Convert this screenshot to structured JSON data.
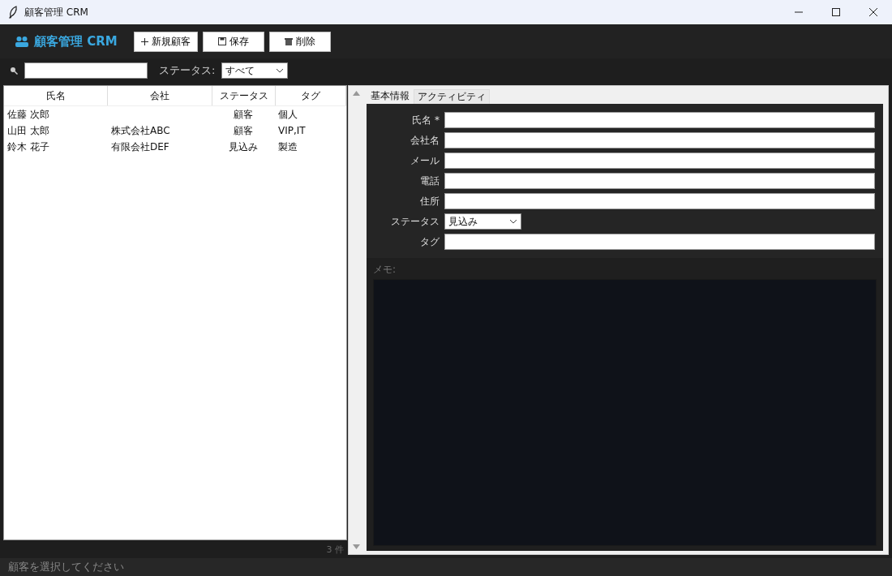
{
  "window": {
    "title": "顧客管理 CRM"
  },
  "header": {
    "title": "顧客管理 CRM",
    "buttons": [
      {
        "label": "新規顧客",
        "kind": "plus"
      },
      {
        "label": "保存",
        "kind": "save"
      },
      {
        "label": "削除",
        "kind": "trash"
      }
    ]
  },
  "filter": {
    "status_label": "ステータス:",
    "status_value": "すべて"
  },
  "table": {
    "columns": [
      "氏名",
      "会社",
      "ステータス",
      "タグ"
    ],
    "rows": [
      {
        "cells": [
          "佐藤 次郎",
          "",
          "顧客",
          "個人"
        ]
      },
      {
        "cells": [
          "山田 太郎",
          "株式会社ABC",
          "顧客",
          "VIP,IT"
        ]
      },
      {
        "cells": [
          "鈴木 花子",
          "有限会社DEF",
          "見込み",
          "製造"
        ]
      }
    ],
    "count": "3 件"
  },
  "tabs": [
    {
      "label": "基本情報",
      "selected": true
    },
    {
      "label": "アクティビティ",
      "selected": false
    }
  ],
  "form": {
    "fields": [
      {
        "label": "氏名 *",
        "kind": "text"
      },
      {
        "label": "会社名",
        "kind": "text"
      },
      {
        "label": "メール",
        "kind": "text"
      },
      {
        "label": "電話",
        "kind": "text"
      },
      {
        "label": "住所",
        "kind": "text"
      },
      {
        "label": "ステータス",
        "kind": "select",
        "value": "見込み"
      },
      {
        "label": "タグ",
        "kind": "text"
      }
    ],
    "memo_label": "メモ:"
  },
  "status_bar": "顧客を選択してください"
}
